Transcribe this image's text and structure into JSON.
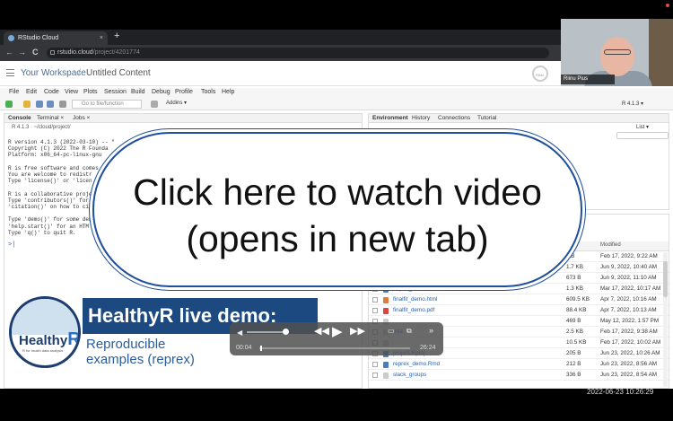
{
  "browser": {
    "tab_title": "RStudio Cloud",
    "tab_close": "×",
    "new_tab": "+",
    "url_host": "rstudio.cloud",
    "url_path": "/project/4201774",
    "nav_back": "←",
    "nav_forward": "→",
    "nav_reload": "C"
  },
  "rstudio_header": {
    "workspace": "Your Workspace",
    "separator": "/",
    "project": "Untitled Content",
    "ram_label": "RAM"
  },
  "menu": [
    "File",
    "Edit",
    "Code",
    "View",
    "Plots",
    "Session",
    "Build",
    "Debug",
    "Profile",
    "Tools",
    "Help"
  ],
  "toolbar": {
    "goto_file_placeholder": "Go to file/function",
    "addins": "Addins ▾",
    "r_version": "R 4.1.3 ▾"
  },
  "console_pane": {
    "tabs": [
      "Console",
      "Terminal ×",
      "Jobs ×"
    ],
    "path": "R 4.1.3 · ~/cloud/project/",
    "text": "R version 4.1.3 (2022-03-10) -- \"\nCopyright (C) 2022 The R Founda\nPlatform: x86_64-pc-linux-gnu\n\nR is free software and comes\nYou are welcome to redistr\nType 'license()' or 'licen\n\nR is a collaborative proje\nType 'contributors()' for\n'citation()' on how to ci\n\nType 'demo()' for some dem\n'help.start()' for an HTM\nType 'q()' to quit R.",
    "prompt": ">|"
  },
  "env_pane": {
    "tabs": [
      "Environment",
      "History",
      "Connections",
      "Tutorial"
    ],
    "list_dropdown": "List ▾"
  },
  "files_pane": {
    "modified_header": "Modified",
    "rows": [
      {
        "name": "",
        "size": "8 B",
        "modified": "Feb 17, 2022, 9:22 AM",
        "color": "#cccccc"
      },
      {
        "name": "",
        "size": "1.7 KB",
        "modified": "Jun 9, 2022, 10:40 AM",
        "color": "#cccccc"
      },
      {
        "name": "",
        "size": "673 B",
        "modified": "Jun 9, 2022, 11:10 AM",
        "color": "#cccccc"
      },
      {
        "name": "export_results.Rmd",
        "size": "1.3 KB",
        "modified": "Mar 17, 2022, 10:17 AM",
        "color": "#4a7bc2"
      },
      {
        "name": "finalfit_demo.html",
        "size": "609.5 KB",
        "modified": "Apr 7, 2022, 10:16 AM",
        "color": "#e07b39"
      },
      {
        "name": "finalfit_demo.pdf",
        "size": "88.4 KB",
        "modified": "Apr 7, 2022, 10:13 AM",
        "color": "#d9453d"
      },
      {
        "name": "",
        "size": "469 B",
        "modified": "May 12, 2022, 1:57 PM",
        "color": "#cccccc"
      },
      {
        "name": ".rda",
        "size": "2.5 KB",
        "modified": "Feb 17, 2022, 9:38 AM",
        "color": "#cccccc"
      },
      {
        "name": "",
        "size": "10.5 KB",
        "modified": "Feb 17, 2022, 10:02 AM",
        "color": "#cccccc"
      },
      {
        "name": "project.Rproj",
        "size": "205 B",
        "modified": "Jun 23, 2022, 10:26 AM",
        "color": "#4a7bc2"
      },
      {
        "name": "reprex_demo.Rmd",
        "size": "212 B",
        "modified": "Jun 23, 2022, 8:56 AM",
        "color": "#4a7bc2"
      },
      {
        "name": "slack_groups",
        "size": "336 B",
        "modified": "Jun 23, 2022, 8:54 AM",
        "color": "#cccccc"
      }
    ]
  },
  "overlay": {
    "line1": "Click here to watch video",
    "line2": "(opens in new tab)"
  },
  "banner": {
    "logo_text": "Healthy",
    "logo_r": "R",
    "logo_sub": "R for health data analysis",
    "title": "HealthyR live demo:",
    "subtitle_l1": "Reproducible",
    "subtitle_l2": "examples (reprex)"
  },
  "video_controls": {
    "current_time": "00:04",
    "duration": "26:24",
    "progress_fraction": 0.003
  },
  "webcam": {
    "name": "Riinu Pius"
  },
  "timestamp": "2022-06-23  10:26:29"
}
